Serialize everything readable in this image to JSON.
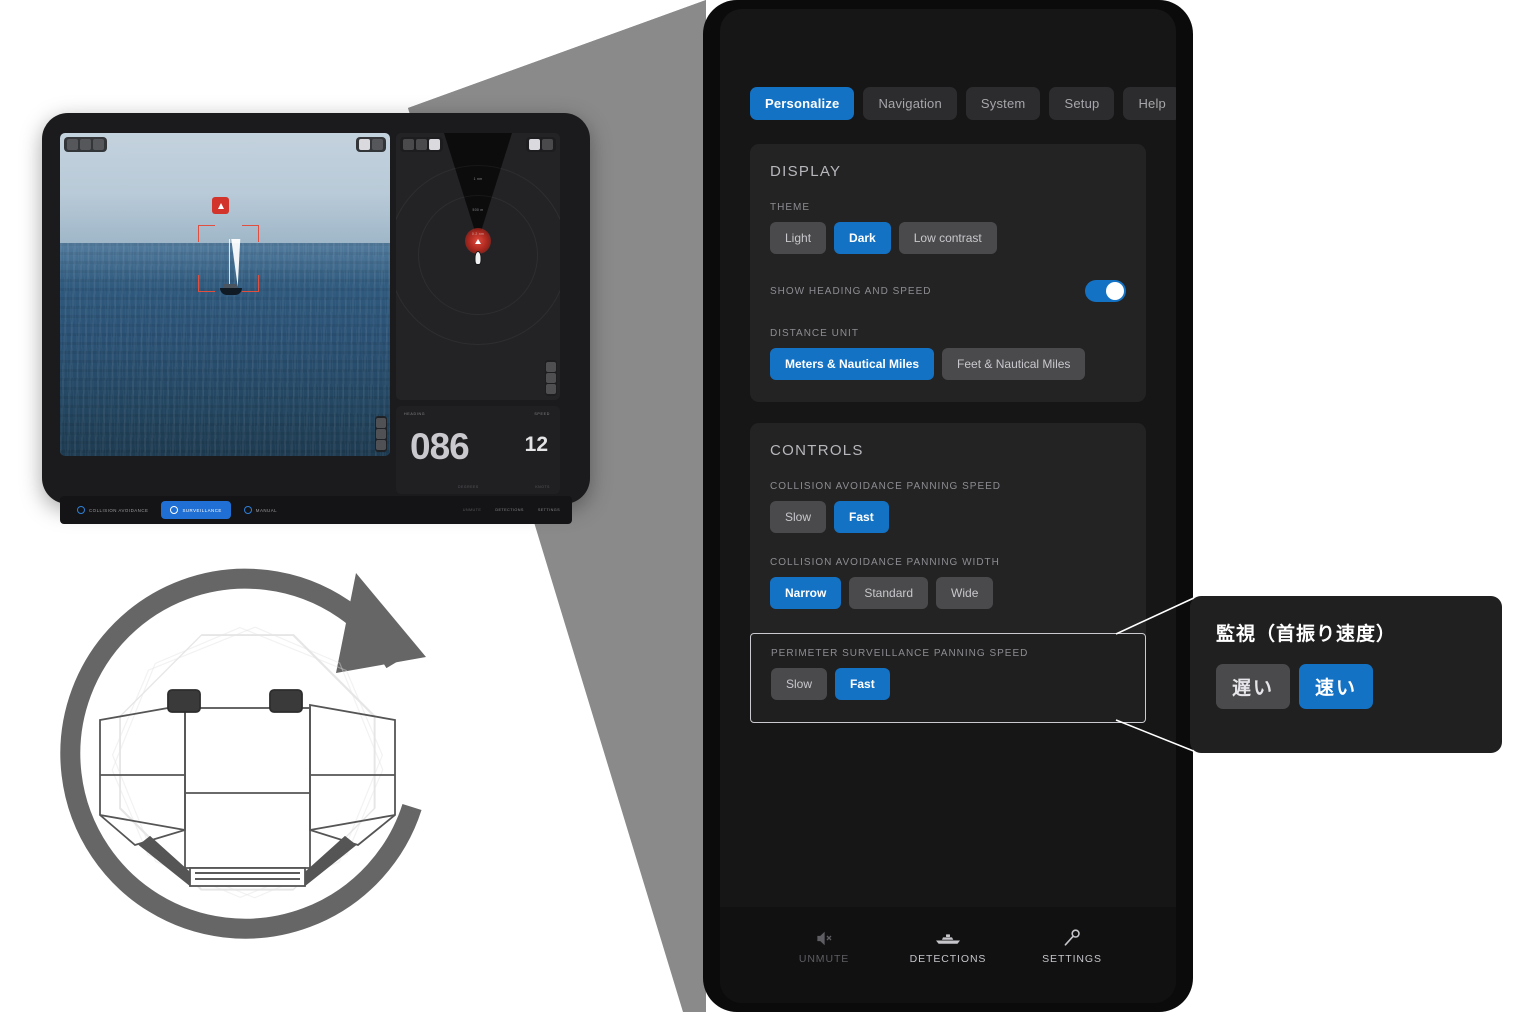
{
  "tablet": {
    "camera_panel": {
      "alert_icon": "warning-triangle-icon",
      "left_buttons": [
        "power-icon",
        "refresh-icon",
        "grid-icon"
      ],
      "right_buttons": [
        "edit-icon",
        "minus-icon"
      ],
      "zoom_buttons": [
        "zoom-in-icon",
        "fit-icon",
        "zoom-out-icon"
      ]
    },
    "radar_panel": {
      "range_labels": [
        "1 nm",
        "500 m"
      ],
      "center_label": "0.2 nm",
      "left_buttons": [
        "power-icon",
        "refresh-icon",
        "grid-icon"
      ],
      "right_buttons": [
        "edit-icon",
        "minus-icon"
      ]
    },
    "readout": {
      "heading_label": "HEADING",
      "heading_value": "086",
      "heading_unit": "DEGREES",
      "speed_label": "SPEED",
      "speed_value": "12",
      "speed_unit": "KNOTS"
    },
    "modes": [
      {
        "label": "COLLISION AVOIDANCE",
        "active": false
      },
      {
        "label": "SURVEILLANCE",
        "active": true
      },
      {
        "label": "MANUAL",
        "active": false
      }
    ],
    "bottom_bar": [
      {
        "label": "UNMUTE",
        "dim": true
      },
      {
        "label": "DETECTIONS",
        "dim": false
      },
      {
        "label": "SETTINGS",
        "dim": false
      }
    ]
  },
  "device": {
    "tabs": [
      {
        "label": "Personalize",
        "selected": true
      },
      {
        "label": "Navigation",
        "selected": false
      },
      {
        "label": "System",
        "selected": false
      },
      {
        "label": "Setup",
        "selected": false
      },
      {
        "label": "Help",
        "selected": false
      }
    ],
    "display": {
      "heading": "DISPLAY",
      "theme_label": "THEME",
      "theme_options": [
        {
          "label": "Light",
          "selected": false
        },
        {
          "label": "Dark",
          "selected": true
        },
        {
          "label": "Low contrast",
          "selected": false
        }
      ],
      "show_heading_label": "SHOW HEADING AND SPEED",
      "show_heading_on": true,
      "distance_unit_label": "DISTANCE UNIT",
      "distance_options": [
        {
          "label": "Meters & Nautical Miles",
          "selected": true
        },
        {
          "label": "Feet & Nautical Miles",
          "selected": false
        }
      ]
    },
    "controls": {
      "heading": "CONTROLS",
      "ca_speed_label": "COLLISION AVOIDANCE PANNING SPEED",
      "ca_speed_options": [
        {
          "label": "Slow",
          "selected": false
        },
        {
          "label": "Fast",
          "selected": true
        }
      ],
      "ca_width_label": "COLLISION AVOIDANCE PANNING WIDTH",
      "ca_width_options": [
        {
          "label": "Narrow",
          "selected": true
        },
        {
          "label": "Standard",
          "selected": false
        },
        {
          "label": "Wide",
          "selected": false
        }
      ],
      "perimeter_label": "PERIMETER SURVEILLANCE PANNING SPEED",
      "perimeter_options": [
        {
          "label": "Slow",
          "selected": false
        },
        {
          "label": "Fast",
          "selected": true
        }
      ]
    },
    "bottom_bar": [
      {
        "label": "UNMUTE",
        "icon": "mute-speaker-icon",
        "dim": true
      },
      {
        "label": "DETECTIONS",
        "icon": "boat-icon",
        "dim": false
      },
      {
        "label": "SETTINGS",
        "icon": "wrench-icon",
        "dim": false
      }
    ]
  },
  "callout": {
    "title": "監視（首振り速度）",
    "options": [
      {
        "label": "遅い",
        "selected": false
      },
      {
        "label": "速い",
        "selected": true
      }
    ]
  },
  "colors": {
    "accent_blue": "#1472c4",
    "alert_red": "#d2342b",
    "panel_bg": "#232324",
    "device_bg": "#161617",
    "wedge_gray": "#8a8a8a"
  }
}
